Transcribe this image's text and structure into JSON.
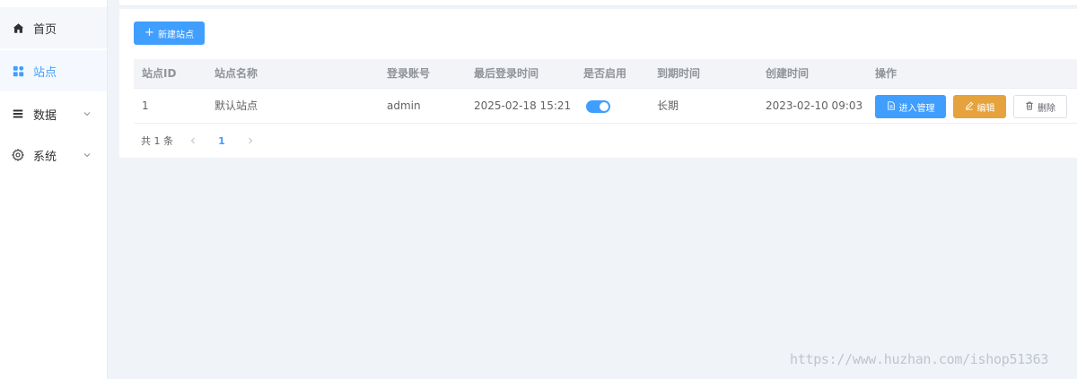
{
  "sidebar": {
    "items": [
      {
        "label": "首页",
        "icon": "home-icon"
      },
      {
        "label": "站点",
        "icon": "grid-icon"
      },
      {
        "label": "数据",
        "icon": "list-icon"
      },
      {
        "label": "系统",
        "icon": "gear-icon"
      }
    ]
  },
  "toolbar": {
    "new_label": "新建站点"
  },
  "table": {
    "columns": [
      "站点ID",
      "站点名称",
      "登录账号",
      "最后登录时间",
      "是否启用",
      "到期时间",
      "创建时间",
      "操作"
    ],
    "rows": [
      {
        "id": "1",
        "name": "默认站点",
        "account": "admin",
        "last_login": "2025-02-18 15:21",
        "enabled": true,
        "expire": "长期",
        "created": "2023-02-10 09:03"
      }
    ],
    "actions": {
      "manage": "进入管理",
      "edit": "编辑",
      "delete": "删除"
    }
  },
  "pagination": {
    "total_text": "共 1 条",
    "current_page": "1"
  },
  "colors": {
    "primary": "#409eff",
    "warning": "#e6a23c",
    "sidebar_bg": "#ffffff",
    "content_bg": "#f0f4f8"
  },
  "watermark": "https://www.huzhan.com/ishop51363"
}
